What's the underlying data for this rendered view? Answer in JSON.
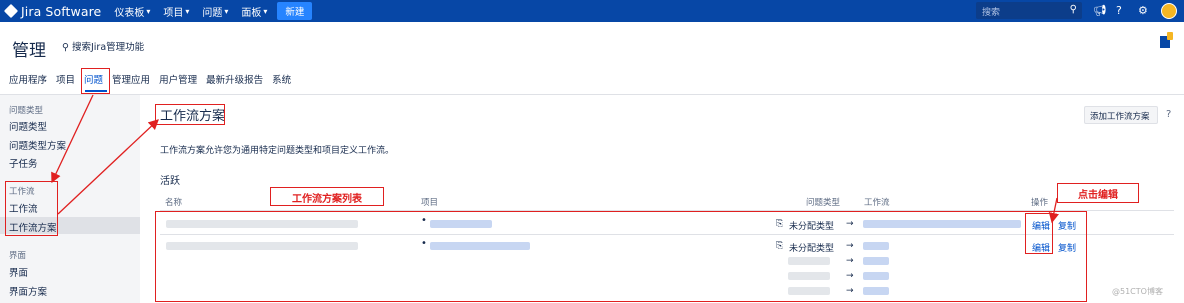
{
  "topnav": {
    "product": "Jira Software",
    "menu": [
      {
        "label": "仪表板"
      },
      {
        "label": "项目"
      },
      {
        "label": "问题"
      },
      {
        "label": "面板"
      }
    ],
    "create": "新建",
    "search_placeholder": "搜索"
  },
  "header": {
    "title": "管理",
    "search": "搜索Jira管理功能"
  },
  "tabs": [
    "应用程序",
    "项目",
    "问题",
    "管理应用",
    "用户管理",
    "最新升级报告",
    "系统"
  ],
  "sidebar": {
    "group1_head": "问题类型",
    "item_issue_types": "问题类型",
    "item_issue_type_schemes": "问题类型方案",
    "item_subtasks": "子任务",
    "group2_head": "工作流",
    "item_workflows": "工作流",
    "item_workflow_schemes": "工作流方案",
    "group3_head": "界面",
    "item_screens": "界面",
    "item_screen_schemes": "界面方案"
  },
  "main": {
    "title": "工作流方案",
    "add_button": "添加工作流方案",
    "description": "工作流方案允许您为通用特定问题类型和项目定义工作流。",
    "active_label": "活跃",
    "columns": {
      "name": "名称",
      "project": "项目",
      "issue_type": "问题类型",
      "workflow": "工作流",
      "actions": "操作"
    },
    "rows": [
      {
        "issue_type": "未分配类型",
        "edit": "编辑",
        "copy": "复制"
      },
      {
        "issue_type": "未分配类型",
        "edit": "编辑",
        "copy": "复制"
      }
    ]
  },
  "annotations": {
    "table_label": "工作流方案列表",
    "click_edit": "点击编辑"
  },
  "watermark": "@51CTO博客",
  "colors": {
    "nav": "#0747a6",
    "annotation": "#e02020",
    "link": "#0052cc"
  }
}
